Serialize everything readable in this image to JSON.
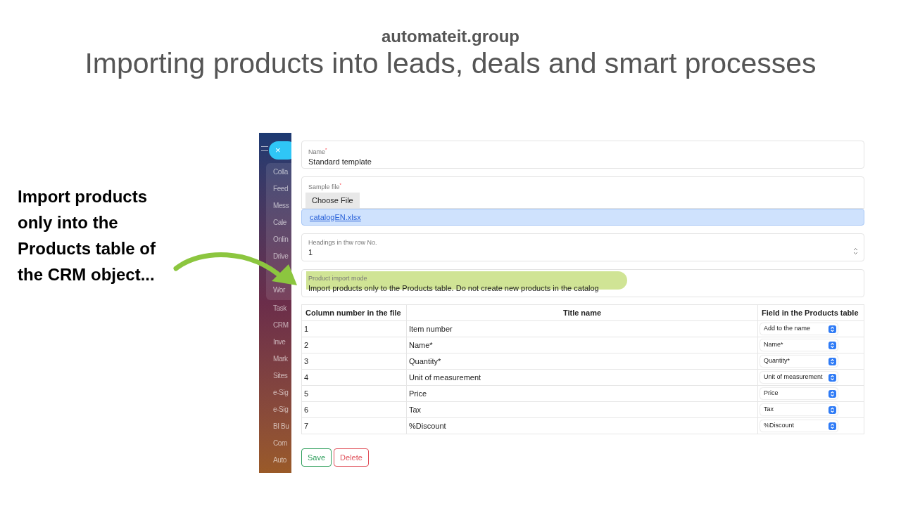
{
  "slide": {
    "site": "automateit.group",
    "title": "Importing products into leads, deals and smart processes",
    "callout": "Import products only into the Products table of the CRM object..."
  },
  "sidebar": {
    "close_icon": "×",
    "group_items": [
      "Colla",
      "Feed",
      "Mess",
      "Cale",
      "Onlin",
      "Drive",
      "Wor"
    ],
    "items": [
      "Task",
      "CRM",
      "Inve",
      "Mark",
      "Sites",
      "e-Sig",
      "e-Sig",
      "BI Bu",
      "Com",
      "Auto"
    ]
  },
  "form": {
    "name": {
      "label": "Name",
      "required_mark": "*",
      "value": "Standard template"
    },
    "sample_file": {
      "label": "Sample file",
      "required_mark": "*",
      "button": "Choose File",
      "file": "catalogEN.xlsx"
    },
    "headings_row": {
      "label": "Headings in thw row No.",
      "value": "1"
    },
    "import_mode": {
      "label": "Product import mode",
      "value": "Import products only to the Products table. Do not create new products in the catalog",
      "highlighted": true
    }
  },
  "table": {
    "columns": [
      "Column number in the file",
      "Title name",
      "Field in the Products table"
    ],
    "rows": [
      {
        "number": "1",
        "title": "Item number",
        "field": "Add to the name"
      },
      {
        "number": "2",
        "title": "Name*",
        "field": "Name*"
      },
      {
        "number": "3",
        "title": "Quantity*",
        "field": "Quantity*"
      },
      {
        "number": "4",
        "title": "Unit of measurement",
        "field": "Unit of measurement"
      },
      {
        "number": "5",
        "title": "Price",
        "field": "Price"
      },
      {
        "number": "6",
        "title": "Tax",
        "field": "Tax"
      },
      {
        "number": "7",
        "title": "%Discount",
        "field": "%Discount"
      }
    ]
  },
  "buttons": [
    {
      "label": "Save",
      "kind": "save"
    },
    {
      "label": "Delete",
      "kind": "delete"
    }
  ]
}
